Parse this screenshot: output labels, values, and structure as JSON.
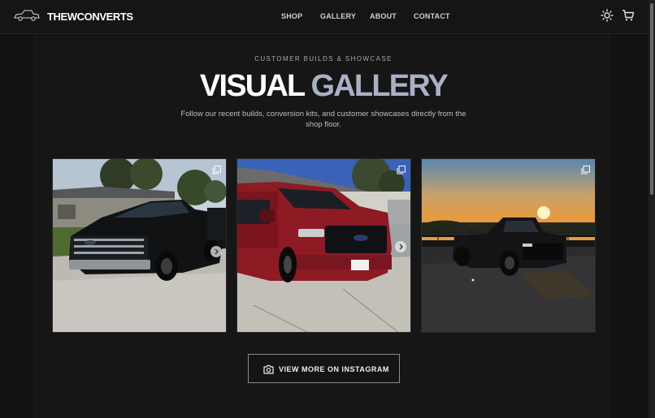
{
  "header": {
    "brand": "THEWCONVERTS",
    "nav": [
      "SHOP",
      "GALLERY",
      "ABOUT",
      "CONTACT"
    ],
    "theme_icon": "sun-icon",
    "cart_icon": "cart-icon"
  },
  "hero": {
    "eyebrow": "CUSTOMER BUILDS & SHOWCASE",
    "title_a": "VISUAL",
    "title_b": "GALLERY",
    "description": "Follow our recent builds, conversion kits, and customer showcases directly from the shop floor."
  },
  "gallery": {
    "items": [
      {
        "subject": "Black pickup truck in driveway",
        "icon": "multiple-images-icon",
        "has_next": true
      },
      {
        "subject": "Red pickup truck front view",
        "icon": "multiple-images-icon",
        "has_next": true
      },
      {
        "subject": "Black pickup truck at sunset",
        "icon": "multiple-images-icon",
        "has_next": false
      }
    ]
  },
  "cta": {
    "label": "VIEW MORE ON INSTAGRAM",
    "icon": "camera-icon"
  },
  "colors": {
    "background": "#121212",
    "title_accent": "#a9b1c5",
    "text": "#ffffff"
  }
}
